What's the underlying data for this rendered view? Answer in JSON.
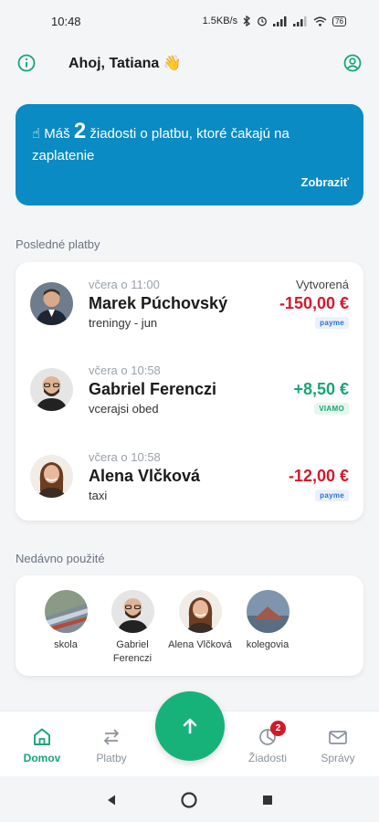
{
  "status_bar": {
    "time": "10:48",
    "net_speed": "1.5KB/s",
    "battery": "76"
  },
  "header": {
    "greeting": "Ahoj, Tatiana 👋",
    "info_icon": "info-icon",
    "profile_icon": "profile-icon"
  },
  "banner": {
    "emoji": "☝",
    "prefix": " Máš ",
    "count": "2",
    "suffix": " žiadosti o platbu, ktoré čakajú na zaplatenie",
    "link": "Zobraziť",
    "color": "#0a8bc4"
  },
  "payments": {
    "title": "Posledné platby",
    "items": [
      {
        "date": "včera o 11:00",
        "name": "Marek Púchovský",
        "note": "treningy - jun",
        "status": "Vytvorená",
        "amount": "-150,00 €",
        "provider": "payme"
      },
      {
        "date": "včera o 10:58",
        "name": "Gabriel Ferenczi",
        "note": "vcerajsi obed",
        "status": "",
        "amount": "+8,50 €",
        "provider": "VIAMO"
      },
      {
        "date": "včera o 10:58",
        "name": "Alena Vlčková",
        "note": "taxi",
        "status": "",
        "amount": "-12,00 €",
        "provider": "payme"
      }
    ]
  },
  "recent": {
    "title": "Nedávno použité",
    "items": [
      {
        "label": "skola"
      },
      {
        "label": "Gabriel Ferenczi"
      },
      {
        "label": "Alena Vlčková"
      },
      {
        "label": "kolegovia"
      }
    ]
  },
  "bottom_nav": {
    "items": [
      {
        "label": "Domov",
        "icon": "home-icon"
      },
      {
        "label": "Platby",
        "icon": "transfer-icon"
      },
      {
        "label": "Žiadosti",
        "icon": "requests-icon",
        "badge": "2"
      },
      {
        "label": "Správy",
        "icon": "mail-icon"
      }
    ],
    "fab_icon": "arrow-up-icon",
    "accent": "#17b27a"
  },
  "colors": {
    "negative": "#d11a2a",
    "positive": "#17a673"
  }
}
